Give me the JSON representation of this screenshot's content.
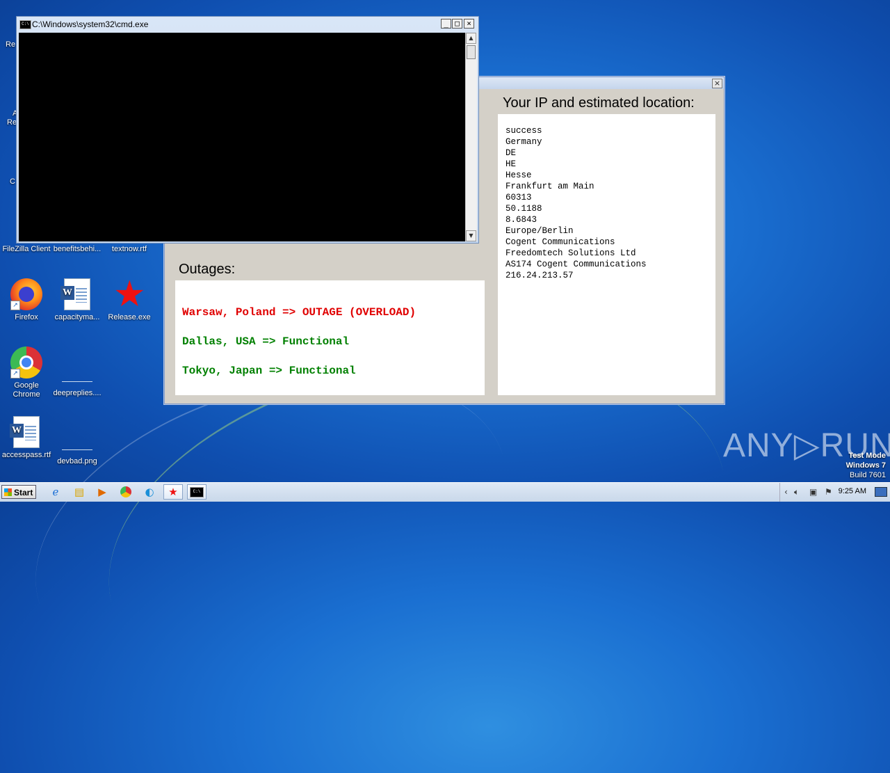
{
  "desktop": {
    "icons": [
      {
        "label": "FileZilla Client"
      },
      {
        "label": "benefitsbehi..."
      },
      {
        "label": "textnow.rtf"
      },
      {
        "label": "Firefox"
      },
      {
        "label": "capacityma..."
      },
      {
        "label": "Release.exe"
      },
      {
        "label": "Google Chrome"
      },
      {
        "label": "deepreplies...."
      },
      {
        "label": "accesspass.rtf"
      },
      {
        "label": "devbad.png"
      }
    ],
    "partial_labels": [
      "Re",
      "A",
      "Re",
      "C"
    ]
  },
  "cmd_window": {
    "title": "C:\\Windows\\system32\\cmd.exe",
    "icon_text": "C:\\",
    "min_glyph": "_",
    "max_glyph": "□",
    "close_glyph": "×"
  },
  "panel": {
    "close_glyph": "×",
    "ip_title": "Your IP and estimated location:",
    "ip_lines": [
      "success",
      "Germany",
      "DE",
      "HE",
      "Hesse",
      "Frankfurt am Main",
      "60313",
      "50.1188",
      "8.6843",
      "Europe/Berlin",
      "Cogent Communications",
      "Freedomtech Solutions Ltd",
      "AS174 Cogent Communications",
      "216.24.213.57"
    ],
    "outages_title": "Outages:",
    "outages": [
      {
        "text": "Warsaw, Poland => OUTAGE (OVERLOAD)",
        "color": "#e00000"
      },
      {
        "text": "Dallas, USA => Functional",
        "color": "#008000"
      },
      {
        "text": "Tokyo, Japan => Functional",
        "color": "#008000"
      }
    ]
  },
  "watermark": "ANY▷RUN",
  "test_mode": {
    "line1": "Test Mode",
    "line2": "Windows 7",
    "line3": "Build 7601"
  },
  "taskbar": {
    "start_label": "Start",
    "clock": "9:25 AM",
    "cmd_icon_text": "C:\\"
  }
}
